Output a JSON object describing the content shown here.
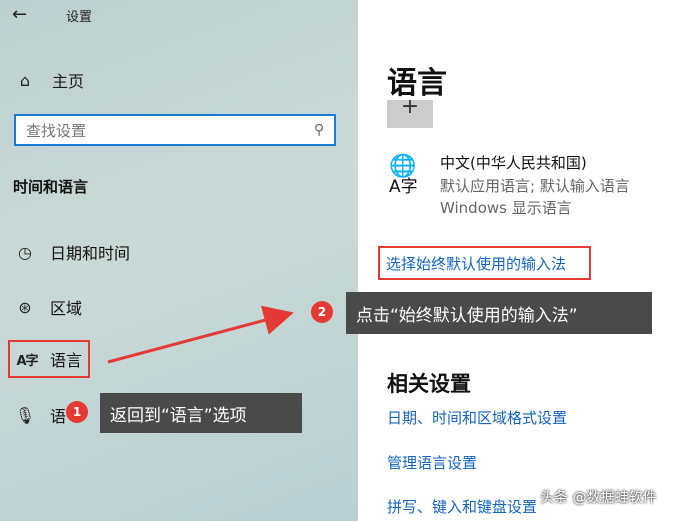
{
  "window": {
    "title": "设置",
    "back_icon": "back-arrow-icon"
  },
  "sidebar": {
    "home_label": "主页",
    "search": {
      "placeholder": "查找设置"
    },
    "section_header": "时间和语言",
    "items": [
      {
        "label": "日期和时间",
        "icon": "calendar-clock-icon"
      },
      {
        "label": "区域",
        "icon": "globe-icon"
      },
      {
        "label": "语言",
        "icon": "language-icon",
        "icon_glyph": "A字"
      },
      {
        "label": "语",
        "icon": "microphone-icon"
      }
    ]
  },
  "main": {
    "title": "语言",
    "add_button": "+",
    "language": {
      "icon_glyph_top": "⊕字",
      "name": "中文(中华人民共和国)",
      "detail1": "默认应用语言; 默认输入语言",
      "detail2": "Windows 显示语言"
    },
    "input_method_link": "选择始终默认使用的输入法",
    "related": {
      "title": "相关设置",
      "links": [
        "日期、时间和区域格式设置",
        "管理语言设置",
        "拼写、键入和键盘设置"
      ]
    }
  },
  "annotations": {
    "step1": {
      "number": "1",
      "text": "返回到“语言”选项"
    },
    "step2": {
      "number": "2",
      "text": "点击“始终默认使用的输入法”"
    },
    "accent_color": "#e53935"
  },
  "watermark": "头条 @数据蛙软件"
}
